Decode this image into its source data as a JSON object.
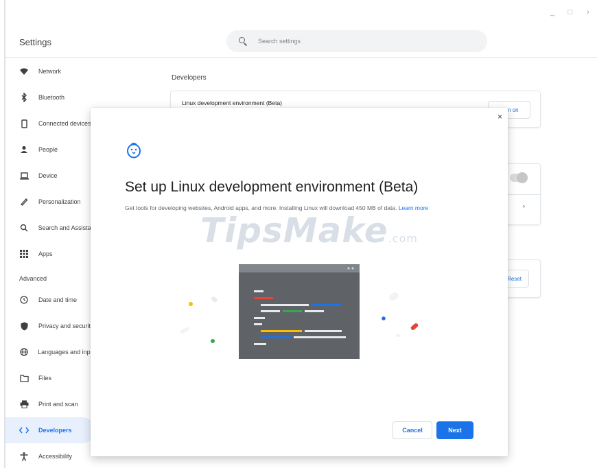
{
  "window": {
    "controls": [
      "_",
      "□",
      "›"
    ]
  },
  "header": {
    "title": "Settings",
    "search_placeholder": "Search settings"
  },
  "sidebar": {
    "items": [
      {
        "label": "Network",
        "icon": "wifi-icon"
      },
      {
        "label": "Bluetooth",
        "icon": "bluetooth-icon"
      },
      {
        "label": "Connected devices",
        "icon": "phone-icon"
      },
      {
        "label": "People",
        "icon": "person-icon"
      },
      {
        "label": "Device",
        "icon": "laptop-icon"
      },
      {
        "label": "Personalization",
        "icon": "pen-icon"
      },
      {
        "label": "Search and Assistant",
        "icon": "search-icon"
      },
      {
        "label": "Apps",
        "icon": "apps-grid-icon"
      }
    ],
    "advanced_heading": "Advanced",
    "advanced_items": [
      {
        "label": "Date and time",
        "icon": "clock-icon"
      },
      {
        "label": "Privacy and security",
        "icon": "shield-icon"
      },
      {
        "label": "Languages and inputs",
        "icon": "globe-icon"
      },
      {
        "label": "Files",
        "icon": "folder-icon"
      },
      {
        "label": "Print and scan",
        "icon": "printer-icon"
      },
      {
        "label": "Developers",
        "icon": "code-icon",
        "active": true
      },
      {
        "label": "Accessibility",
        "icon": "accessibility-icon"
      }
    ]
  },
  "main": {
    "section_title": "Developers",
    "linux_row_label": "Linux development environment (Beta)",
    "turn_on_label": "Turn on",
    "reset_label": "Reset",
    "chevron": "›"
  },
  "dialog": {
    "close": "×",
    "title": "Set up Linux development environment (Beta)",
    "description": "Get tools for developing websites, Android apps, and more. Installing Linux will download 450 MB of data.",
    "learn_more": "Learn more",
    "watermark": "TipsMake",
    "watermark_suffix": ".com",
    "cancel_label": "Cancel",
    "next_label": "Next"
  },
  "colors": {
    "accent": "#1a73e8",
    "active_bg": "#e8f0fe",
    "terminal_bg": "#5f6368"
  }
}
